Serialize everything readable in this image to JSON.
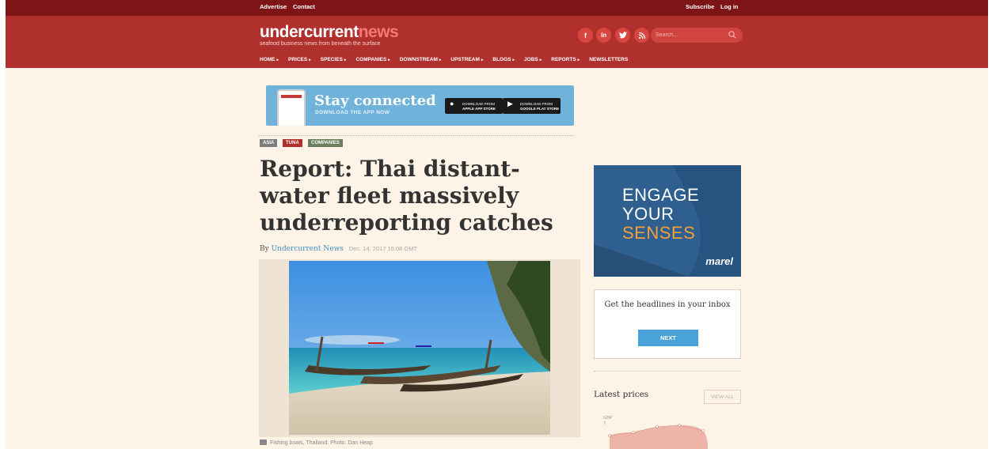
{
  "topbar": {
    "advertise": "Advertise",
    "contact": "Contact",
    "subscribe": "Subscribe",
    "login": "Log in"
  },
  "header": {
    "logo_part1": "undercurrent",
    "logo_part2": "news",
    "tagline": "seafood business news from beneath the surface",
    "search_placeholder": "Search...",
    "social": [
      "f",
      "in",
      "t",
      "rss"
    ],
    "colors": {
      "topbar": "#7e1415",
      "header": "#b0302e",
      "background": "#fdf3e7",
      "link": "#3f8fbf",
      "button": "#4aa3d8"
    }
  },
  "nav": {
    "items": [
      "HOME",
      "PRICES",
      "SPECIES",
      "COMPANIES",
      "DOWNSTREAM",
      "UPSTREAM",
      "BLOGS",
      "JOBS",
      "REPORTS",
      "NEWSLETTERS"
    ]
  },
  "banner": {
    "title": "Stay connected",
    "subtitle": "DOWNLOAD THE APP NOW",
    "apple_line1": "DOWNLOAD FROM",
    "apple_line2": "APPLE APP STORE",
    "google_line1": "DOWNLOAD FROM",
    "google_line2": "GOOGLE PLAY STORE"
  },
  "article": {
    "tags": [
      "ASIA",
      "TUNA",
      "COMPANIES"
    ],
    "headline": "Report: Thai distant-water fleet massively underreporting catches",
    "by": "By",
    "author": "Undercurrent News",
    "date": "Dec. 14, 2017 16:08 GMT",
    "caption": "Fishing boats, Thailand. Photo: Dan Heap"
  },
  "ad": {
    "line1": "ENGAGE",
    "line2": "YOUR",
    "line3": "SENSES",
    "brand": "marel"
  },
  "newsletter": {
    "prompt": "Get the headlines in your inbox",
    "button": "NEXT"
  },
  "prices": {
    "title": "Latest prices",
    "view_all": "VIEW ALL",
    "unit": "GBP",
    "tick": "7"
  }
}
